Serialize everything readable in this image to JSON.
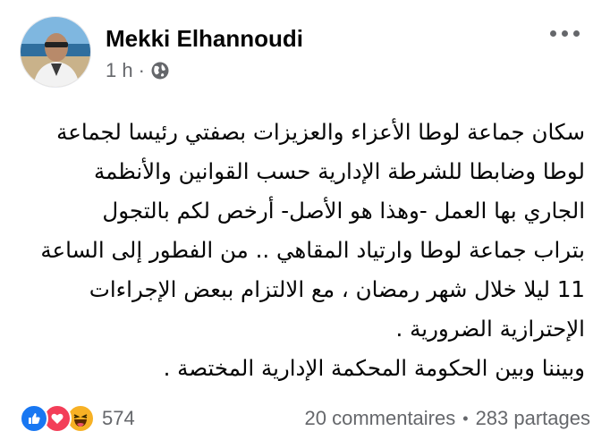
{
  "post": {
    "author": "Mekki Elhannoudi",
    "time": "1 h",
    "time_separator": "·",
    "privacy_icon": "globe-icon",
    "lines": [
      "سكان جماعة لوطا الأعزاء والعزيزات بصفتي رئيسا لجماعة",
      "لوطا وضابطا للشرطة الإدارية حسب القوانين والأنظمة",
      "الجاري بها العمل -وهذا هو الأصل- أرخص لكم بالتجول",
      "بتراب جماعة لوطا وارتياد المقاهي .. من الفطور إلى الساعة",
      "11 ليلا خلال شهر رمضان ، مع الالتزام ببعض الإجراءات",
      "الإحترازية الضرورية .",
      "وبيننا وبين الحكومة المحكمة الإدارية المختصة ."
    ]
  },
  "footer": {
    "reaction_icons": [
      "like-icon",
      "love-icon",
      "haha-icon"
    ],
    "reaction_count": "574",
    "comments": "20 commentaires",
    "separator": "•",
    "shares": "283 partages"
  },
  "colors": {
    "like": "#1877f2",
    "love": "#f33e58",
    "haha": "#f7b125",
    "secondary_text": "#65676b"
  }
}
